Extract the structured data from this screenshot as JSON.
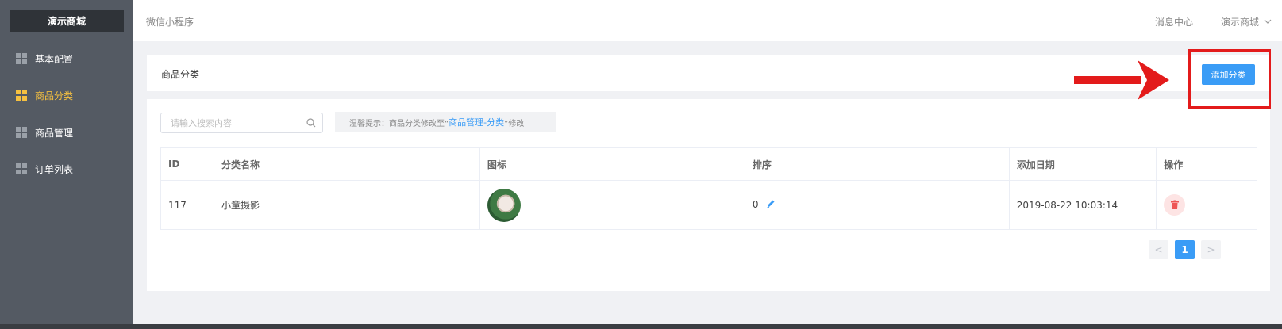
{
  "sidebar": {
    "brand": "演示商城",
    "items": [
      {
        "label": "基本配置",
        "active": false
      },
      {
        "label": "商品分类",
        "active": true
      },
      {
        "label": "商品管理",
        "active": false
      },
      {
        "label": "订单列表",
        "active": false
      }
    ]
  },
  "topbar": {
    "title": "微信小程序",
    "messages": "消息中心",
    "user": "演示商城"
  },
  "page": {
    "title": "商品分类",
    "add_button": "添加分类"
  },
  "search": {
    "placeholder": "请输入搜索内容"
  },
  "tip": {
    "prefix": "温馨提示：商品分类修改至“",
    "link": "商品管理-分类",
    "suffix": "”修改"
  },
  "table": {
    "headers": [
      "ID",
      "分类名称",
      "图标",
      "排序",
      "添加日期",
      "操作"
    ],
    "rows": [
      {
        "id": "117",
        "name": "小童摄影",
        "sort": "0",
        "date": "2019-08-22 10:03:14"
      }
    ]
  },
  "pagination": {
    "prev": "<",
    "current": "1",
    "next": ">"
  },
  "colors": {
    "accent": "#3a9cf6",
    "sidebar_bg": "#545a63",
    "active_nav": "#f5c040",
    "annotation": "#e31b1b"
  }
}
